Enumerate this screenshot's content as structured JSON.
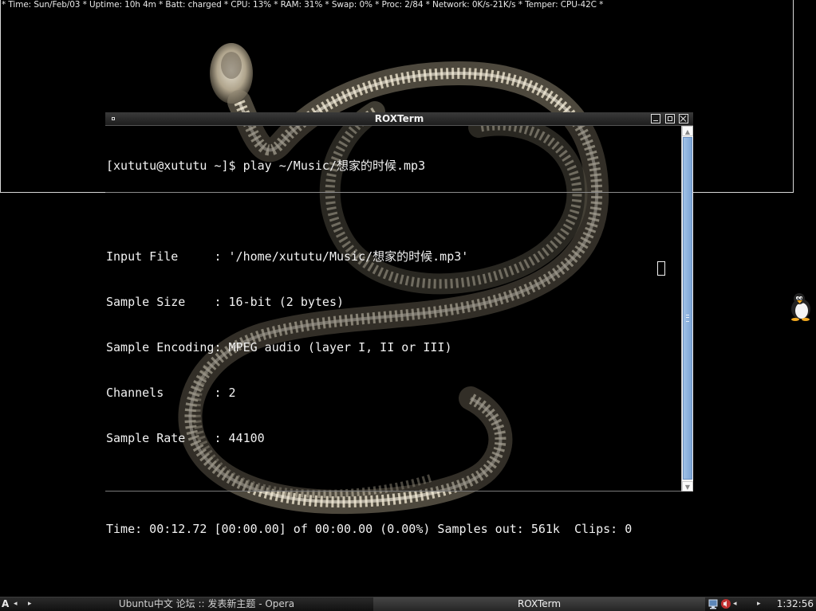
{
  "status_bar": {
    "text": "* Time: Sun/Feb/03 * Uptime: 10h 4m * Batt: charged * CPU: 13% * RAM: 31% * Swap: 0% * Proc: 2/84 * Network: 0K/s-21K/s * Temper: CPU-42C *"
  },
  "terminal": {
    "title": "ROXTerm",
    "lines": [
      "[xututu@xututu ~]$ play ~/Music/想家的时候.mp3",
      "",
      "Input File     : '/home/xututu/Music/想家的时候.mp3'",
      "Sample Size    : 16-bit (2 bytes)",
      "Sample Encoding: MPEG audio (layer I, II or III)",
      "Channels       : 2",
      "Sample Rate    : 44100",
      "",
      "Time: 00:12.72 [00:00.00] of 00:00.00 (0.00%) Samples out: 561k  Clips: 0"
    ]
  },
  "taskbar": {
    "desktop_label": "A",
    "prev_arrow": "◂",
    "next_arrow": "▸",
    "tasks": [
      {
        "label": "Ubuntu中文 论坛 :: 发表新主题 - Opera",
        "active": false
      },
      {
        "label": "ROXTerm",
        "active": true
      }
    ],
    "tray_prev": "◂",
    "tray_next": "▸",
    "clock": "1:32:56"
  },
  "icons": {
    "desktop": "penguin-icon",
    "tray": [
      "network-icon",
      "volume-icon"
    ]
  }
}
